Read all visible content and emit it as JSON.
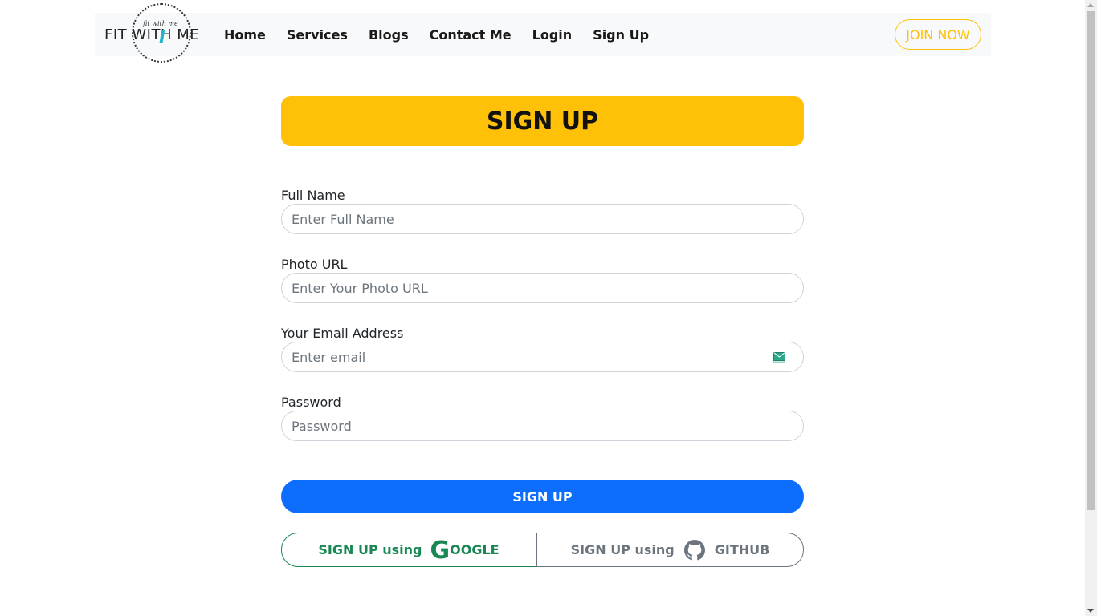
{
  "navbar": {
    "logo_small_text": "fit with me",
    "logo_text": "FIT WITH ME",
    "links": [
      "Home",
      "Services",
      "Blogs",
      "Contact Me",
      "Login",
      "Sign Up"
    ],
    "join_label": "JOIN NOW"
  },
  "form": {
    "title": "SIGN UP",
    "fields": [
      {
        "label": "Full Name",
        "placeholder": "Enter Full Name"
      },
      {
        "label": "Photo URL",
        "placeholder": "Enter Your Photo URL"
      },
      {
        "label": "Your Email Address",
        "placeholder": "Enter email"
      },
      {
        "label": "Password",
        "placeholder": "Password"
      }
    ],
    "submit_label": "SIGN UP",
    "google_prefix": "SIGN UP using",
    "google_g": "G",
    "google_rest": "OOGLE",
    "github_prefix": "SIGN UP using",
    "github_label": "GITHUB"
  },
  "colors": {
    "accent": "#ffc107",
    "primary": "#0d6efd",
    "google": "#198754",
    "github": "#6c757d"
  },
  "icons": [
    "email-icon",
    "github-icon"
  ]
}
